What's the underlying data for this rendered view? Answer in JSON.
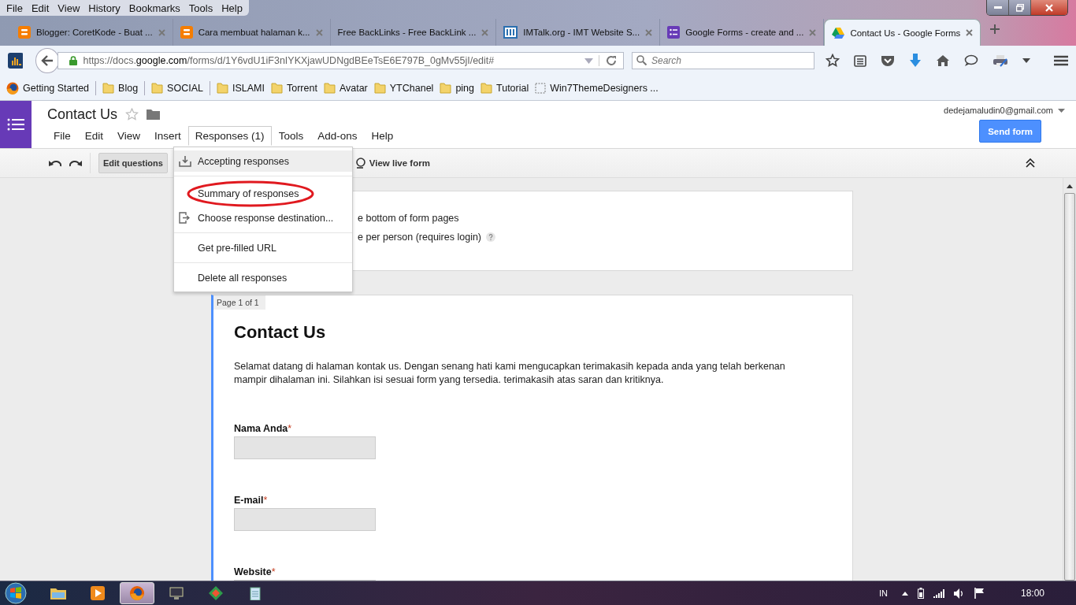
{
  "browser_menu": [
    "File",
    "Edit",
    "View",
    "History",
    "Bookmarks",
    "Tools",
    "Help"
  ],
  "tabs": [
    {
      "title": "Blogger: CoretKode - Buat ...",
      "kind": "blogger",
      "selected": false
    },
    {
      "title": "Cara membuat halaman k...",
      "kind": "blogger",
      "selected": false
    },
    {
      "title": "Free BackLinks - Free BackLink ...",
      "kind": "none",
      "selected": false
    },
    {
      "title": "IMTalk.org - IMT Website S...",
      "kind": "imt",
      "selected": false
    },
    {
      "title": "Google Forms - create and ...",
      "kind": "forms",
      "selected": false
    },
    {
      "title": "Contact Us - Google Forms",
      "kind": "drive",
      "selected": true
    }
  ],
  "address": {
    "prefix": "https://docs.",
    "domain": "google.com",
    "path": "/forms/d/1Y6vdU1iF3nIYKXjawUDNgdBEeTsE6E797B_0gMv55jI/edit#"
  },
  "search": {
    "placeholder": "Search"
  },
  "bookmarks": [
    {
      "label": "Getting Started",
      "kind": "firefox"
    },
    {
      "label": "Blog",
      "kind": "folder"
    },
    {
      "label": "SOCIAL",
      "kind": "folder"
    },
    {
      "label": "ISLAMI",
      "kind": "folder"
    },
    {
      "label": "Torrent",
      "kind": "folder"
    },
    {
      "label": "Avatar",
      "kind": "folder"
    },
    {
      "label": "YTChanel",
      "kind": "folder"
    },
    {
      "label": "ping",
      "kind": "folder"
    },
    {
      "label": "Tutorial",
      "kind": "folder"
    },
    {
      "label": "Win7ThemeDesigners ...",
      "kind": "page"
    }
  ],
  "app": {
    "title": "Contact Us",
    "account": "dedejamaludin0@gmail.com",
    "send_button": "Send form",
    "menu": [
      {
        "label": "File",
        "selected": false
      },
      {
        "label": "Edit",
        "selected": false
      },
      {
        "label": "View",
        "selected": false
      },
      {
        "label": "Insert",
        "selected": false
      },
      {
        "label": "Responses (1)",
        "selected": true
      },
      {
        "label": "Tools",
        "selected": false
      },
      {
        "label": "Add-ons",
        "selected": false
      },
      {
        "label": "Help",
        "selected": false
      }
    ],
    "toolbar": {
      "edit_button": "Edit questions",
      "live_button": "View live form"
    }
  },
  "dropdown": [
    {
      "label": "Accepting responses",
      "kind": "download",
      "selected": true
    },
    {
      "label": "Summary of responses",
      "kind": "plain",
      "selected": false,
      "circled": true
    },
    {
      "label": "Choose response destination...",
      "kind": "export",
      "selected": false
    },
    {
      "label": "Get pre-filled URL",
      "kind": "plain",
      "selected": false
    },
    {
      "label": "Delete all responses",
      "kind": "plain",
      "selected": false
    }
  ],
  "settings_lines": [
    "e bottom of form pages",
    "e per person (requires login)"
  ],
  "form": {
    "page_label": "Page 1 of 1",
    "title": "Contact Us",
    "description": "Selamat datang di halaman kontak us. Dengan senang hati kami mengucapkan terimakasih kepada anda yang telah berkenan mampir dihalaman ini. Silahkan isi sesuai form yang tersedia. terimakasih atas saran dan kritiknya.",
    "required_mark": "*",
    "questions": [
      {
        "label": "Nama Anda",
        "required": true
      },
      {
        "label": "E-mail",
        "required": true
      },
      {
        "label": "Website",
        "required": true
      }
    ]
  },
  "taskbar": {
    "language": "IN",
    "time": "18:00"
  }
}
